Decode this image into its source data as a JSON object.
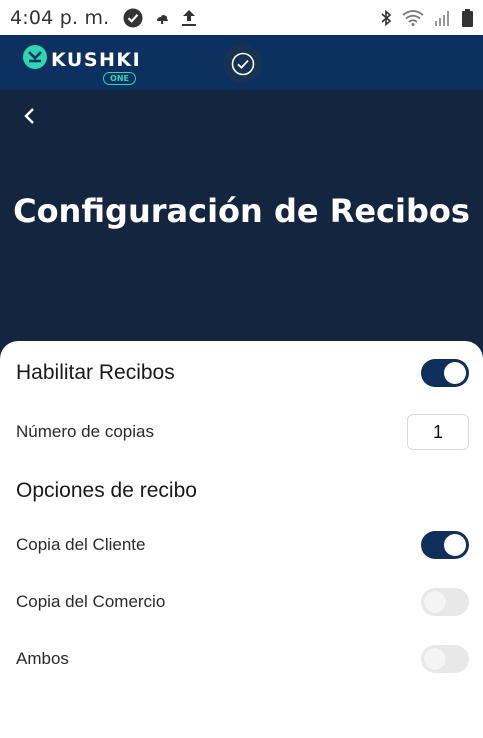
{
  "status_bar": {
    "time": "4:04 p. m.",
    "icons": [
      "check-badge-icon",
      "cloud-icon",
      "upload-icon",
      "bluetooth-icon",
      "wifi-icon",
      "signal-icon",
      "battery-icon"
    ]
  },
  "header": {
    "logo_text": "KUSHKI",
    "logo_badge": "ONE",
    "accent_color": "#2ed6b2",
    "background_color": "#0c3060"
  },
  "hero": {
    "title": "Configuración de Recibos",
    "background_color": "#14253f"
  },
  "settings": {
    "enable_receipts": {
      "label": "Habilitar Recibos",
      "enabled": true
    },
    "copies": {
      "label": "Número de copias",
      "value": "1"
    },
    "options_title": "Opciones de recibo",
    "options": [
      {
        "label": "Copia del Cliente",
        "enabled": true
      },
      {
        "label": "Copia del Comercio",
        "enabled": false
      },
      {
        "label": "Ambos",
        "enabled": false
      }
    ]
  },
  "colors": {
    "toggle_on": "#0d2f5a",
    "toggle_off": "#e8e8e8"
  }
}
